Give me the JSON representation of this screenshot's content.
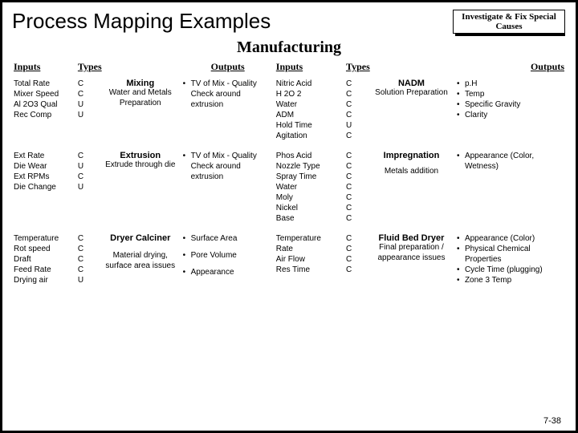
{
  "title": "Process Mapping Examples",
  "badge": {
    "l1": "Investigate & Fix Special",
    "l2": "Causes"
  },
  "subtitle": "Manufacturing",
  "hdr": {
    "inputs": "Inputs",
    "types": "Types",
    "outputs": "Outputs"
  },
  "left": {
    "row1": {
      "in": [
        "Total Rate",
        "Mixer Speed",
        "Al 2O3 Qual",
        "Rec Comp"
      ],
      "ty": [
        "C",
        "C",
        "U",
        "U"
      ],
      "stepT": "Mixing",
      "stepS": "Water and Metals Preparation",
      "out": [
        "TV of Mix - Quality Check around extrusion"
      ]
    },
    "row2": {
      "in": [
        "Ext Rate",
        "Die Wear",
        "Ext RPMs",
        "Die Change"
      ],
      "ty": [
        "C",
        "U",
        "C",
        "U"
      ],
      "stepT": "Extrusion",
      "stepS": "Extrude through die",
      "out": [
        "TV of Mix - Quality Check around extrusion"
      ]
    },
    "row3": {
      "in": [
        "Temperature",
        "Rot speed",
        "Draft",
        "Feed Rate",
        "Drying air"
      ],
      "ty": [
        "C",
        "C",
        "C",
        "C",
        "U"
      ],
      "stepT": "Dryer Calciner",
      "stepS": "Material drying, surface area issues",
      "out": [
        "Surface Area",
        "Pore Volume",
        "Appearance"
      ]
    }
  },
  "right": {
    "row1": {
      "in": [
        "Nitric Acid",
        "H 2O 2",
        "Water",
        "ADM",
        "Hold Time",
        "Agitation"
      ],
      "ty": [
        "C",
        "C",
        "C",
        "C",
        "U",
        "C"
      ],
      "stepT": "NADM",
      "stepS": "Solution Preparation",
      "out": [
        "p.H",
        "Temp",
        "Specific Gravity",
        "Clarity"
      ]
    },
    "row2": {
      "in": [
        "Phos Acid",
        "Nozzle Type",
        "Spray Time",
        "Water",
        "Moly",
        "Nickel",
        "Base"
      ],
      "ty": [
        "C",
        "C",
        "C",
        "C",
        "C",
        "C",
        "C"
      ],
      "stepT": "Impregnation",
      "stepS": "Metals addition",
      "out": [
        "Appearance (Color, Wetness)"
      ]
    },
    "row3": {
      "in": [
        "Temperature",
        "Rate",
        "Air Flow",
        "Res Time"
      ],
      "ty": [
        "C",
        "C",
        "C",
        "C"
      ],
      "stepT": "Fluid Bed Dryer",
      "stepS": "Final preparation / appearance issues",
      "out": [
        "Appearance (Color)",
        "Physical Chemical Properties",
        "Cycle Time (plugging)",
        "Zone 3 Temp"
      ]
    }
  },
  "pagenum": "7-38"
}
